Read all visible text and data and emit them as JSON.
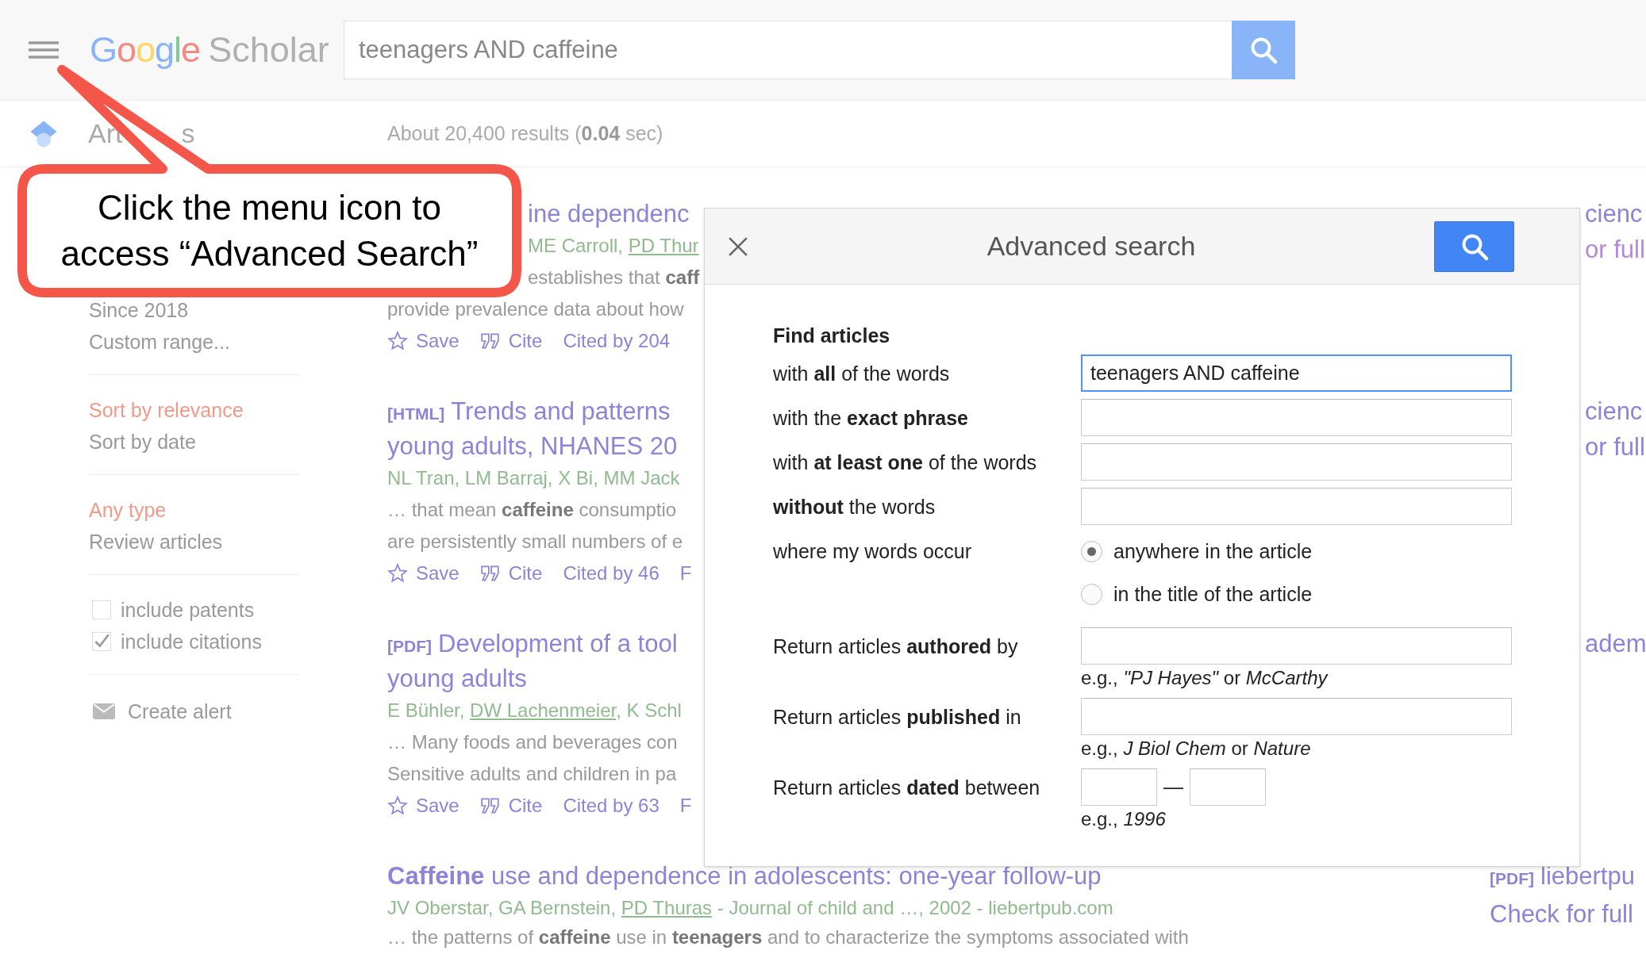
{
  "header": {
    "logo": {
      "letters": [
        {
          "text": "G",
          "color": "#8ab4f8"
        },
        {
          "text": "o",
          "color": "#f28b82"
        },
        {
          "text": "o",
          "color": "#fdd663"
        },
        {
          "text": "g",
          "color": "#8ab4f8"
        },
        {
          "text": "l",
          "color": "#81c995"
        },
        {
          "text": "e",
          "color": "#f28b82"
        }
      ],
      "product": "Scholar"
    },
    "search": {
      "value": "teenagers AND caffeine"
    }
  },
  "subheader": {
    "title_parts": [
      "Art",
      "s"
    ],
    "result_count": "About 20,400 results (**0.04** sec)"
  },
  "sidebar": {
    "groups": [
      {
        "kind": "links",
        "items": [
          {
            "label": "Since 2018",
            "selected": false
          },
          {
            "label": "Custom range...",
            "selected": false
          }
        ]
      },
      {
        "kind": "links",
        "items": [
          {
            "label": "Sort by relevance",
            "selected": true
          },
          {
            "label": "Sort by date",
            "selected": false
          }
        ]
      },
      {
        "kind": "links",
        "items": [
          {
            "label": "Any type",
            "selected": true
          },
          {
            "label": "Review articles",
            "selected": false
          }
        ]
      },
      {
        "kind": "checks",
        "items": [
          {
            "label": "include patents",
            "checked": false
          },
          {
            "label": "include citations",
            "checked": true
          }
        ]
      },
      {
        "kind": "alert",
        "items": [
          {
            "label": "Create alert"
          }
        ]
      }
    ]
  },
  "results": [
    {
      "title": [
        "ine dependenc"
      ],
      "authors": [
        {
          "text": "ME Carroll, ",
          "link": false
        },
        {
          "text": "PD Thur",
          "link": true
        }
      ],
      "snippet": [
        "establishes that **caff**",
        "provide prevalence data about how"
      ],
      "actions": [
        {
          "kind": "save",
          "label": "Save"
        },
        {
          "kind": "cite",
          "label": "Cite"
        },
        {
          "kind": "cited",
          "label": "Cited by 204"
        }
      ],
      "side": [
        {
          "text": "cienc",
          "visited": false
        },
        {
          "text": "or full",
          "visited": true
        }
      ]
    },
    {
      "format": "[HTML]",
      "title": [
        "Trends and patterns",
        "young adults, NHANES 20"
      ],
      "authors": [
        {
          "text": "NL Tran, LM Barraj, X Bi, MM Jack",
          "link": false
        }
      ],
      "snippet": [
        "… that mean **caffeine** consumptio",
        "are persistently small numbers of e"
      ],
      "actions": [
        {
          "kind": "save",
          "label": "Save"
        },
        {
          "kind": "cite",
          "label": "Cite"
        },
        {
          "kind": "cited",
          "label": "Cited by 46"
        },
        {
          "kind": "more",
          "label": "F"
        }
      ],
      "side": [
        {
          "text": "cienc",
          "visited": false
        },
        {
          "text": "or full",
          "visited": false
        }
      ]
    },
    {
      "format": "[PDF]",
      "title": [
        "Development of a tool",
        "young adults"
      ],
      "authors": [
        {
          "text": "E Bühler, ",
          "link": false
        },
        {
          "text": "DW Lachenmeier",
          "link": true
        },
        {
          "text": ", K Schl",
          "link": false
        }
      ],
      "snippet": [
        "… Many foods and beverages con",
        "Sensitive adults and children in pa"
      ],
      "actions": [
        {
          "kind": "save",
          "label": "Save"
        },
        {
          "kind": "cite",
          "label": "Cite"
        },
        {
          "kind": "cited",
          "label": "Cited by 63"
        },
        {
          "kind": "more",
          "label": "F"
        }
      ],
      "side": [
        {
          "text": "adem",
          "visited": false
        }
      ]
    },
    {
      "title": [
        "**Caffeine** use and dependence in adolescents: one-year follow-up"
      ],
      "authors": [
        {
          "text": "JV Oberstar, GA Bernstein, ",
          "link": false
        },
        {
          "text": "PD Thuras",
          "link": true
        },
        {
          "text": " - Journal of child and …, 2002 - liebertpub.com",
          "link": false
        }
      ],
      "snippet": [
        "… the patterns of **caffeine** use in **teenagers** and to characterize the symptoms associated with"
      ],
      "side_format": "[PDF]",
      "side": [
        {
          "text": "liebertpu",
          "visited": false
        },
        {
          "text": "Check for full",
          "visited": false
        }
      ]
    }
  ],
  "dialog": {
    "title": "Advanced search",
    "section": "Find articles",
    "rows": [
      {
        "kind": "text",
        "label": "with **all** of the words",
        "value": "teenagers AND caffeine",
        "focused": true
      },
      {
        "kind": "text",
        "label": "with the **exact phrase**",
        "focused": false
      },
      {
        "kind": "text",
        "label": "with **at least one** of the words",
        "focused": false
      },
      {
        "kind": "text",
        "label": "**without** the words",
        "focused": false
      },
      {
        "kind": "radio",
        "label": "where my words occur",
        "options": [
          {
            "label": "anywhere in the article",
            "selected": true
          },
          {
            "label": "in the title of the article",
            "selected": false
          }
        ]
      },
      {
        "kind": "text",
        "label": "Return articles **authored** by",
        "hint": "e.g., *\"PJ Hayes\"* or *McCarthy*",
        "focused": false
      },
      {
        "kind": "text",
        "label": "Return articles **published** in",
        "hint": "e.g., *J Biol Chem* or *Nature*",
        "focused": false
      },
      {
        "kind": "range",
        "label": "Return articles **dated** between",
        "separator": "—",
        "hint": "e.g., *1996*"
      }
    ]
  },
  "callout": {
    "lines": [
      "Click the menu icon to",
      "access “Advanced Search”"
    ]
  }
}
